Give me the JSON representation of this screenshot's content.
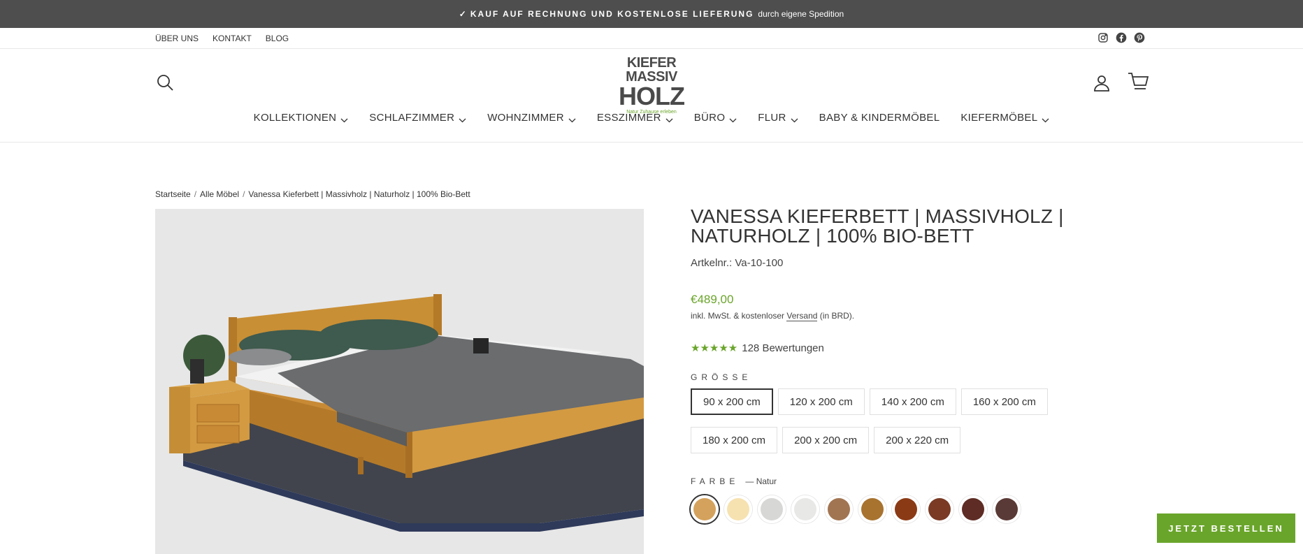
{
  "announcement": {
    "check": "✓",
    "bold": "KAUF AUF RECHNUNG UND KOSTENLOSE LIEFERUNG",
    "rest": "durch eigene Spedition"
  },
  "utility_nav": [
    "ÜBER UNS",
    "KONTAKT",
    "BLOG"
  ],
  "social_icons": [
    "instagram-icon",
    "facebook-icon",
    "pinterest-icon"
  ],
  "logo": {
    "line1": "KIEFER",
    "line2": "MASSIV",
    "line3": "HOLZ",
    "tagline": "Natur Zuhause erleben"
  },
  "main_nav": [
    {
      "label": "KOLLEKTIONEN",
      "dropdown": true
    },
    {
      "label": "SCHLAFZIMMER",
      "dropdown": true
    },
    {
      "label": "WOHNZIMMER",
      "dropdown": true
    },
    {
      "label": "ESSZIMMER",
      "dropdown": true
    },
    {
      "label": "BÜRO",
      "dropdown": true
    },
    {
      "label": "FLUR",
      "dropdown": true
    },
    {
      "label": "BABY & KINDERMÖBEL",
      "dropdown": false
    },
    {
      "label": "KIEFERMÖBEL",
      "dropdown": true
    }
  ],
  "breadcrumb": {
    "items": [
      "Startseite",
      "Alle Möbel",
      "Vanessa Kieferbett | Massivholz | Naturholz | 100% Bio-Bett"
    ],
    "separator": "/"
  },
  "product": {
    "title": "VANESSA KIEFERBETT | MASSIVHOLZ | NATURHOLZ | 100% BIO-BETT",
    "sku": "Artkelnr.: Va-10-100",
    "price": "€489,00",
    "tax_prefix": "inkl. MwSt. & kostenloser",
    "tax_link": "Versand",
    "tax_suffix": "(in BRD).",
    "stars": "★★★★★",
    "reviews": "128 Bewertungen",
    "size_label": "GRÖSSE",
    "sizes": [
      "90 x 200 cm",
      "120 x 200 cm",
      "140 x 200 cm",
      "160 x 200 cm",
      "180 x 200 cm",
      "200 x 200 cm",
      "200 x 220 cm"
    ],
    "selected_size_index": 0,
    "color_label": "FARBE",
    "color_dash": "—",
    "color_value": "Natur",
    "colors": [
      "#d4a25c",
      "#f6e2b0",
      "#d7d7d5",
      "#e8e8e6",
      "#a27552",
      "#a8732f",
      "#8b3a16",
      "#7a3a24",
      "#5e2c24",
      "#5a3a36"
    ],
    "selected_color_index": 0
  },
  "cta": {
    "label": "JETZT BESTELLEN",
    "color": "#6aa52b"
  },
  "colors": {
    "accent": "#6aa52b",
    "announcement_bg": "#4e4e4e"
  }
}
